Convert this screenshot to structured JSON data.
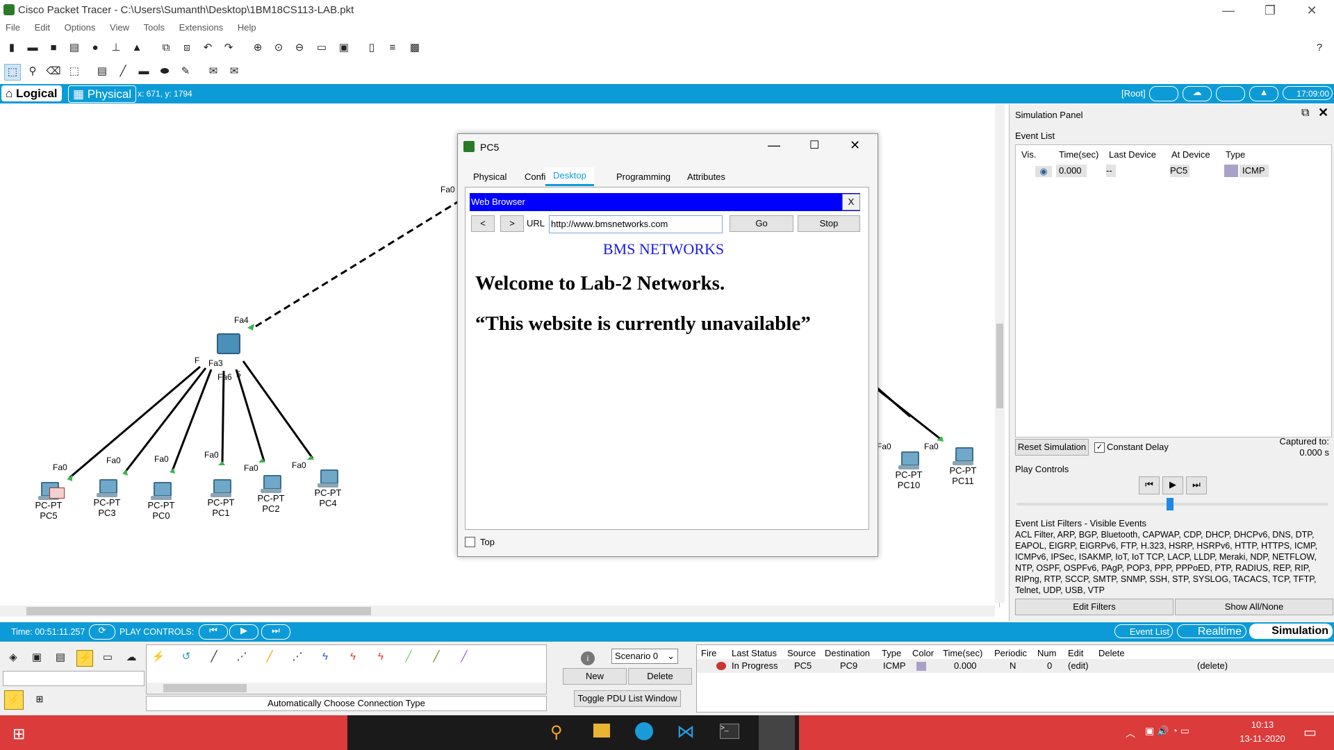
{
  "window": {
    "title": "Cisco Packet Tracer - C:\\Users\\Sumanth\\Desktop\\1BM18CS113-LAB.pkt"
  },
  "menu": [
    "File",
    "Edit",
    "Options",
    "View",
    "Tools",
    "Extensions",
    "Help"
  ],
  "modebar": {
    "logical": "Logical",
    "physical": "Physical",
    "coords": "x: 671, y: 1794",
    "root": "[Root]",
    "clock": "17:09:00"
  },
  "canvas": {
    "nodes": [
      {
        "type": "PC-PT",
        "name": "PC5",
        "port": "Fa0"
      },
      {
        "type": "PC-PT",
        "name": "PC3",
        "port": "Fa0"
      },
      {
        "type": "PC-PT",
        "name": "PC0",
        "port": "Fa0"
      },
      {
        "type": "PC-PT",
        "name": "PC1",
        "port": "Fa0"
      },
      {
        "type": "PC-PT",
        "name": "PC2",
        "port": "Fa0"
      },
      {
        "type": "PC-PT",
        "name": "PC4",
        "port": "Fa0"
      },
      {
        "type": "PC-PT",
        "name": "PC10",
        "port": "Fa0"
      },
      {
        "type": "PC-PT",
        "name": "PC11",
        "port": "Fa0"
      }
    ],
    "switch_ports": [
      "Fa4",
      "Fa3",
      "Fa6",
      "F",
      "5",
      "Fa0"
    ]
  },
  "dialog": {
    "title": "PC5",
    "tabs": [
      "Physical",
      "Config",
      "Desktop",
      "Programming",
      "Attributes"
    ],
    "active_tab": "Desktop",
    "browser": {
      "title": "Web Browser",
      "close": "X",
      "back": "<",
      "forward": ">",
      "url_label": "URL",
      "url": "http://www.bmsnetworks.com",
      "go": "Go",
      "stop": "Stop",
      "heading": "BMS NETWORKS",
      "line1": "Welcome to Lab-2 Networks.",
      "line2": "“This website is currently unavailable”"
    },
    "top_label": "Top"
  },
  "simpanel": {
    "title": "Simulation Panel",
    "event_list_label": "Event List",
    "columns": [
      "Vis.",
      "Time(sec)",
      "Last Device",
      "At Device",
      "Type"
    ],
    "events": [
      {
        "time": "0.000",
        "last": "--",
        "at": "PC5",
        "type": "ICMP"
      }
    ],
    "reset": "Reset Simulation",
    "constant_delay": "Constant Delay",
    "captured_label": "Captured to:",
    "captured_value": "0.000 s",
    "play_controls": "Play Controls",
    "filters_label": "Event List Filters - Visible Events",
    "filters_text": "ACL Filter, ARP, BGP, Bluetooth, CAPWAP, CDP, DHCP, DHCPv6, DNS, DTP, EAPOL, EIGRP, EIGRPv6, FTP, H.323, HSRP, HSRPv6, HTTP, HTTPS, ICMP, ICMPv6, IPSec, ISAKMP, IoT, IoT TCP, LACP, LLDP, Meraki, NDP, NETFLOW, NTP, OSPF, OSPFv6, PAgP, POP3, PPP, PPPoED, PTP, RADIUS, REP, RIP, RIPng, RTP, SCCP, SMTP, SNMP, SSH, STP, SYSLOG, TACACS, TCP, TFTP, Telnet, UDP, USB, VTP",
    "edit_filters": "Edit Filters",
    "show_all": "Show All/None"
  },
  "timebar": {
    "time": "Time: 00:51:11.257",
    "play_controls": "PLAY CONTROLS:",
    "event_list": "Event List",
    "realtime": "Realtime",
    "simulation": "Simulation"
  },
  "bottom": {
    "conn_type": "Automatically Choose Connection Type",
    "scenario": "Scenario 0",
    "new": "New",
    "delete": "Delete",
    "toggle": "Toggle PDU List Window",
    "pdu_columns": [
      "Fire",
      "Last Status",
      "Source",
      "Destination",
      "Type",
      "Color",
      "Time(sec)",
      "Periodic",
      "Num",
      "Edit",
      "Delete"
    ],
    "pdu_rows": [
      {
        "status": "In Progress",
        "source": "PC5",
        "dest": "PC9",
        "type": "ICMP",
        "time": "0.000",
        "periodic": "N",
        "num": "0",
        "edit": "(edit)",
        "delete": "(delete)"
      }
    ]
  },
  "taskbar": {
    "time": "10:13",
    "date": "13-11-2020"
  },
  "colors": {
    "accent": "#0d9bd7",
    "browser_title": "#0000ff",
    "taskbar": "#dc3b3b"
  }
}
